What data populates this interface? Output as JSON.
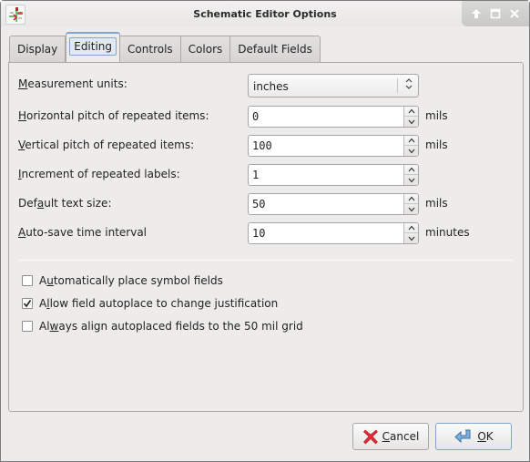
{
  "window": {
    "title": "Schematic Editor Options",
    "app_icon": "schematic-editor-icon",
    "controls": [
      {
        "name": "keep-above",
        "icon": "arrow-up-icon"
      },
      {
        "name": "maximize",
        "icon": "maximize-icon"
      },
      {
        "name": "close",
        "icon": "close-icon"
      }
    ]
  },
  "tabs": [
    {
      "label": "Display",
      "active": false
    },
    {
      "label": "Editing",
      "active": true
    },
    {
      "label": "Controls",
      "active": false
    },
    {
      "label": "Colors",
      "active": false
    },
    {
      "label": "Default Fields",
      "active": false
    }
  ],
  "fields": {
    "measurement_units": {
      "pre": "",
      "mnemonic": "M",
      "post": "easurement units:",
      "value": "inches"
    },
    "horizontal_pitch": {
      "pre": "",
      "mnemonic": "H",
      "post": "orizontal pitch of repeated items:",
      "value": "0",
      "unit": "mils"
    },
    "vertical_pitch": {
      "pre": "",
      "mnemonic": "V",
      "post": "ertical pitch of repeated items:",
      "value": "100",
      "unit": "mils"
    },
    "label_increment": {
      "pre": "",
      "mnemonic": "I",
      "post": "ncrement of repeated labels:",
      "value": "1",
      "unit": ""
    },
    "text_size": {
      "pre": "Def",
      "mnemonic": "a",
      "post": "ult text size:",
      "value": "50",
      "unit": "mils"
    },
    "autosave_interval": {
      "pre": "",
      "mnemonic": "A",
      "post": "uto-save time interval",
      "value": "10",
      "unit": "minutes"
    }
  },
  "checkboxes": [
    {
      "pre": "A",
      "mnemonic": "u",
      "post": "tomatically place symbol fields",
      "checked": false
    },
    {
      "pre": "A",
      "mnemonic": "l",
      "post": "low field autoplace to change justification",
      "checked": true
    },
    {
      "pre": "Al",
      "mnemonic": "w",
      "post": "ays align autoplaced fields to the 50 mil grid",
      "checked": false
    }
  ],
  "buttons": {
    "cancel": {
      "mnemonic": "C",
      "post": "ancel",
      "icon": "cancel-x-icon"
    },
    "ok": {
      "mnemonic": "O",
      "post": "K",
      "icon": "return-arrow-icon"
    }
  },
  "colors": {
    "accent": "#7fa6d0",
    "cancel_icon": "#d9303a",
    "ok_icon": "#5b8fc7"
  }
}
